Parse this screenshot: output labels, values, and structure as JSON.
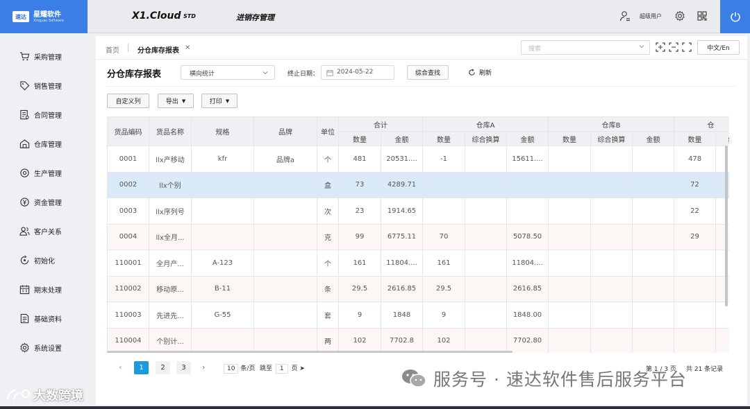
{
  "header": {
    "logo_badge": "速达",
    "logo_name": "星耀软件",
    "logo_sub": "Xingyao Software",
    "app_title": "X1.Cloud",
    "app_edition": "STD",
    "app_module": "进销存管理",
    "user_name": "超级用户"
  },
  "sidebar": {
    "items": [
      {
        "label": "采购管理",
        "icon": "cart-icon"
      },
      {
        "label": "销售管理",
        "icon": "tag-icon"
      },
      {
        "label": "合同管理",
        "icon": "contract-icon"
      },
      {
        "label": "仓库管理",
        "icon": "warehouse-icon"
      },
      {
        "label": "生产管理",
        "icon": "production-icon"
      },
      {
        "label": "资金管理",
        "icon": "money-icon"
      },
      {
        "label": "客户关系",
        "icon": "customer-icon"
      },
      {
        "label": "初始化",
        "icon": "init-icon"
      },
      {
        "label": "期末处理",
        "icon": "calendar-icon"
      },
      {
        "label": "基础资料",
        "icon": "document-icon"
      },
      {
        "label": "系统设置",
        "icon": "settings-icon"
      }
    ]
  },
  "tabs": {
    "home": "首页",
    "active": "分仓库存报表",
    "close": "×"
  },
  "toolbar": {
    "search_placeholder": "搜索",
    "lang": "中文/En"
  },
  "filters": {
    "title": "分仓库存报表",
    "mode": "横向统计",
    "date_label": "终止日期：",
    "date_value": "2024-05-22",
    "query_btn": "综合查找",
    "refresh_btn": "刷新"
  },
  "actions": {
    "custom_cols": "自定义列",
    "export": "导出",
    "print": "打印"
  },
  "table": {
    "headers": {
      "code": "货品编码",
      "name": "货品名称",
      "spec": "规格",
      "brand": "品牌",
      "unit": "单位",
      "group_total": "合计",
      "group_a": "仓库A",
      "group_b": "仓库B",
      "group_c": "仓",
      "qty": "数量",
      "amount": "金额",
      "conv": "综合换算",
      "conv_c": "综"
    },
    "rows": [
      {
        "code": "0001",
        "name": "llx产移动",
        "spec": "kfr",
        "brand": "品牌a",
        "unit": "个",
        "t_qty": "481",
        "t_amt": "20531....",
        "a_qty": "-1",
        "a_conv": "",
        "a_amt": "15611....",
        "b_qty": "",
        "b_conv": "",
        "b_amt": "",
        "c_qty": "478"
      },
      {
        "code": "0002",
        "name": "llx个别",
        "spec": "",
        "brand": "",
        "unit": "盒",
        "t_qty": "73",
        "t_amt": "4289.71",
        "a_qty": "",
        "a_conv": "",
        "a_amt": "",
        "b_qty": "",
        "b_conv": "",
        "b_amt": "",
        "c_qty": "72"
      },
      {
        "code": "0003",
        "name": "llx序列号",
        "spec": "",
        "brand": "",
        "unit": "次",
        "t_qty": "23",
        "t_amt": "1914.65",
        "a_qty": "",
        "a_conv": "",
        "a_amt": "",
        "b_qty": "",
        "b_conv": "",
        "b_amt": "",
        "c_qty": "22"
      },
      {
        "code": "0004",
        "name": "llx全月...",
        "spec": "",
        "brand": "",
        "unit": "克",
        "t_qty": "99",
        "t_amt": "6775.11",
        "a_qty": "70",
        "a_conv": "",
        "a_amt": "5078.50",
        "b_qty": "",
        "b_conv": "",
        "b_amt": "",
        "c_qty": "29"
      },
      {
        "code": "110001",
        "name": "全月产...",
        "spec": "A-123",
        "brand": "",
        "unit": "个",
        "t_qty": "161",
        "t_amt": "11804....",
        "a_qty": "161",
        "a_conv": "",
        "a_amt": "11804....",
        "b_qty": "",
        "b_conv": "",
        "b_amt": "",
        "c_qty": ""
      },
      {
        "code": "110002",
        "name": "移动原...",
        "spec": "B-11",
        "brand": "",
        "unit": "条",
        "t_qty": "29.5",
        "t_amt": "2616.85",
        "a_qty": "29.5",
        "a_conv": "",
        "a_amt": "2616.85",
        "b_qty": "",
        "b_conv": "",
        "b_amt": "",
        "c_qty": ""
      },
      {
        "code": "110003",
        "name": "先进先...",
        "spec": "G-55",
        "brand": "",
        "unit": "套",
        "t_qty": "9",
        "t_amt": "1848",
        "a_qty": "9",
        "a_conv": "",
        "a_amt": "1848.00",
        "b_qty": "",
        "b_conv": "",
        "b_amt": "",
        "c_qty": ""
      },
      {
        "code": "110004",
        "name": "个别计...",
        "spec": "",
        "brand": "",
        "unit": "两",
        "t_qty": "102",
        "t_amt": "7702.8",
        "a_qty": "102",
        "a_conv": "",
        "a_amt": "7702.80",
        "b_qty": "",
        "b_conv": "",
        "b_amt": "",
        "c_qty": ""
      }
    ]
  },
  "pagination": {
    "prev": "‹",
    "pages": [
      "1",
      "2",
      "3"
    ],
    "next": "›",
    "size_value": "10",
    "size_suffix": "条/页",
    "jump_label": "跳至",
    "jump_value": "1",
    "jump_suffix": "页",
    "page_info": "第 1 / 3 页",
    "total": "共 21 条记录"
  },
  "watermarks": {
    "left": "大数跨境",
    "right": "服务号 · 速达软件售后服务平台"
  },
  "colors": {
    "accent": "#3b7fe6",
    "page_active": "#1a9ae0",
    "selected_row": "#dbeaf8",
    "alt_row": "#fcf6f4"
  }
}
